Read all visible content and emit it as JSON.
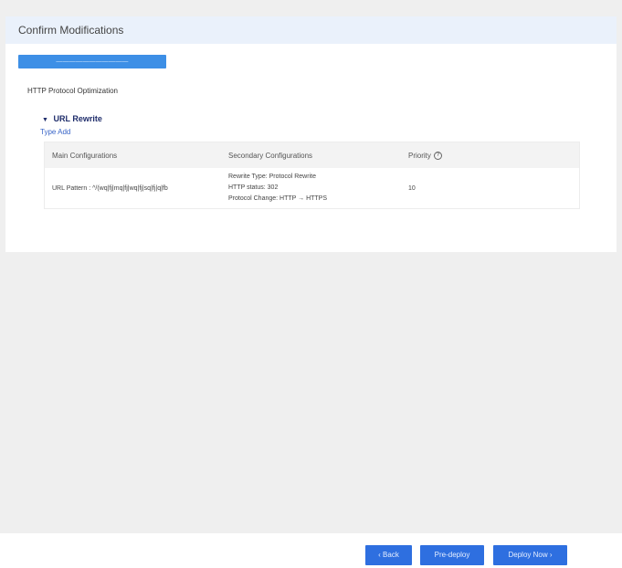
{
  "card": {
    "title": "Confirm Modifications",
    "progress_label": "———————————",
    "section_title": "HTTP Protocol Optimization",
    "rule": {
      "caret": "▼",
      "title": "URL Rewrite",
      "type_add": "Type Add"
    }
  },
  "table": {
    "headers": {
      "main": "Main Configurations",
      "secondary": "Secondary Configurations",
      "priority": "Priority",
      "priority_icon": "?"
    },
    "rows": [
      {
        "main": "URL Pattern : ^/(wq|fj|mq|fj|wq|fj|sq|fj|q|fb",
        "secondary": [
          "Rewrite Type: Protocol Rewrite",
          "HTTP status: 302",
          "Protocol Change: HTTP → HTTPS"
        ],
        "priority": "10"
      }
    ]
  },
  "footer": {
    "back_label": "‹ Back",
    "predeploy_label": "Pre-deploy",
    "deploy_label": "Deploy Now ›"
  },
  "colors": {
    "accent": "#2e6fe0",
    "progress": "#3d8fe6",
    "header_bg": "#eaf1fb",
    "link": "#3a66c8"
  }
}
